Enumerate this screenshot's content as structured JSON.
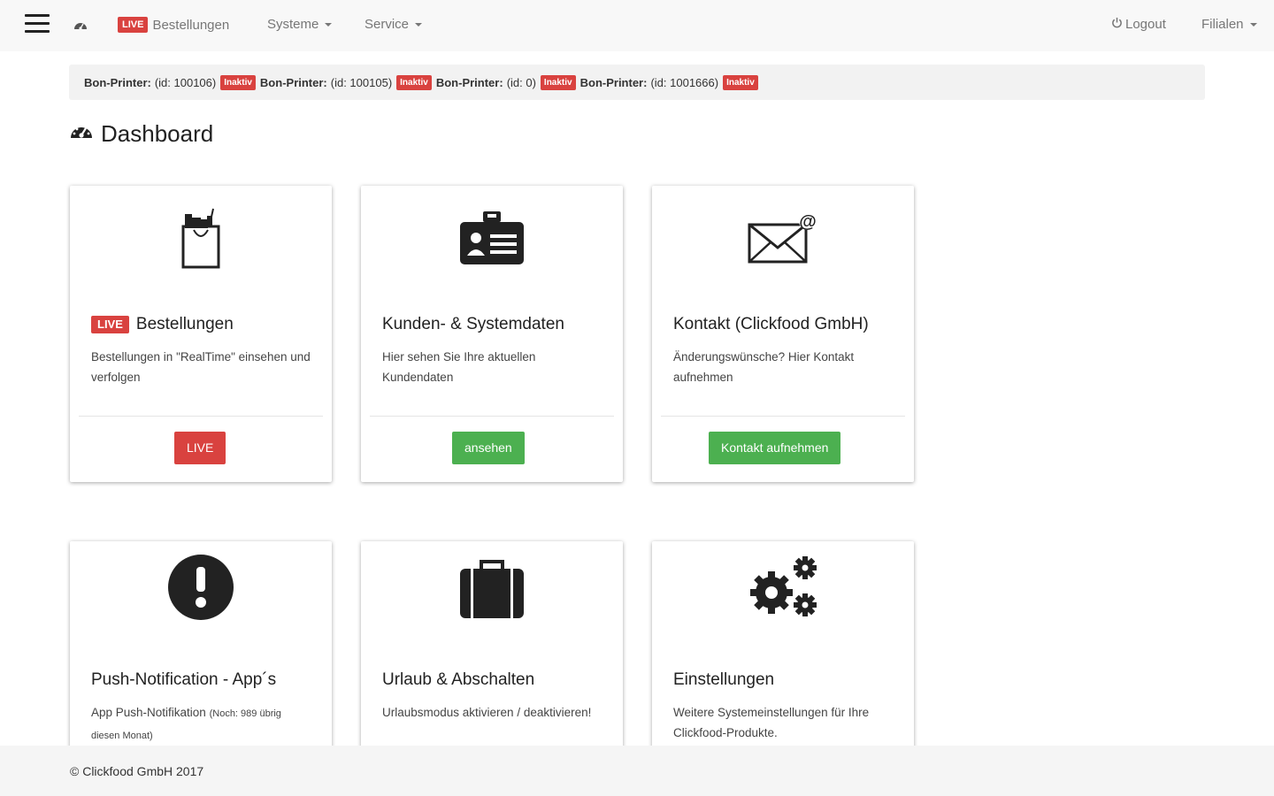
{
  "navbar": {
    "live_badge": "LIVE",
    "bestellungen": "Bestellungen",
    "systeme": "Systeme",
    "service": "Service",
    "logout": "Logout",
    "filialen": "Filialen"
  },
  "printers": [
    {
      "label": "Bon-Printer:",
      "id_text": "(id: 100106)",
      "status": "Inaktiv"
    },
    {
      "label": "Bon-Printer:",
      "id_text": "(id: 100105)",
      "status": "Inaktiv"
    },
    {
      "label": "Bon-Printer:",
      "id_text": "(id: 0)",
      "status": "Inaktiv"
    },
    {
      "label": "Bon-Printer:",
      "id_text": "(id: 1001666)",
      "status": "Inaktiv"
    }
  ],
  "page": {
    "title": "Dashboard"
  },
  "cards": [
    {
      "icon": "shopping-bag-icon",
      "badge": "LIVE",
      "title": "Bestellungen",
      "text": "Bestellungen in \"RealTime\" einsehen und verfolgen",
      "button": "LIVE",
      "button_color": "#d9423f"
    },
    {
      "icon": "id-card-icon",
      "title": "Kunden- & Systemdaten",
      "text": "Hier sehen Sie Ihre aktuellen Kundendaten",
      "button": "ansehen",
      "button_color": "#4cb050"
    },
    {
      "icon": "envelope-at-icon",
      "title": "Kontakt (Clickfood GmbH)",
      "text": "Änderungswünsche? Hier Kontakt aufnehmen",
      "button": "Kontakt aufnehmen",
      "button_color": "#4cb050"
    },
    {
      "icon": "exclamation-circle-icon",
      "title": "Push-Notification - App´s",
      "text": "App Push-Notifikation",
      "text_small": "(Noch: 989 übrig diesen Monat)"
    },
    {
      "icon": "briefcase-icon",
      "title": "Urlaub & Abschalten",
      "text": "Urlaubsmodus aktivieren / deaktivieren!"
    },
    {
      "icon": "gears-icon",
      "title": "Einstellungen",
      "text": "Weitere Systemeinstellungen für Ihre Clickfood-Produkte."
    }
  ],
  "footer": {
    "text": "© Clickfood GmbH 2017"
  },
  "colors": {
    "live_red": "#d9423f",
    "button_green": "#4cb050",
    "navbar_bg": "#f8f8f8"
  }
}
